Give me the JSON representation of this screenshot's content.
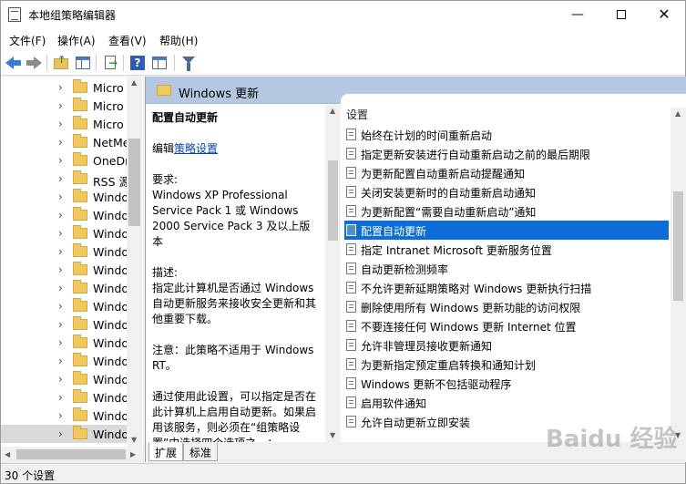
{
  "window": {
    "title": "本地组策略编辑器",
    "minimize_glyph": "—",
    "close_glyph": "✕"
  },
  "menu": [
    "文件(F)",
    "操作(A)",
    "查看(V)",
    "帮助(H)"
  ],
  "tree": {
    "items": [
      "Micro",
      "Micro",
      "Micro",
      "NetMe",
      "OneDr",
      "RSS 源",
      "Windo",
      "Windo",
      "Windo",
      "Windo",
      "Windo",
      "Windo",
      "Windo",
      "Windo",
      "Windo",
      "Windo",
      "Windo",
      "Windo",
      "Windo",
      "Windo"
    ],
    "selected_index": 19,
    "chevron": "›"
  },
  "panel": {
    "header": "Windows 更新",
    "description": {
      "title": "配置自动更新",
      "edit_prefix": "编辑",
      "edit_link": "策略设置",
      "requirements_label": "要求:",
      "requirements_text": "Windows XP Professional Service Pack 1 或 Windows 2000 Service Pack 3 及以上版本",
      "desc_label": "描述:",
      "desc_text": "指定此计算机是否通过 Windows 自动更新服务来接收安全更新和其他重要下载。",
      "note_text": "注意：此策略不适用于 Windows RT。",
      "usage_text": "通过使用此设置，可以指定是否在此计算机上启用自动更新。如果启用该服务，则必须在“组策略设置”中选择四个选项之一："
    },
    "list_header": "设置",
    "settings": [
      "始终在计划的时间重新启动",
      "指定更新安装进行自动重新启动之前的最后期限",
      "为更新配置自动重新启动提醒通知",
      "关闭安装更新时的自动重新启动通知",
      "为更新配置“需要自动重新启动”通知",
      "配置自动更新",
      "指定 Intranet Microsoft 更新服务位置",
      "自动更新检测频率",
      "不允许更新延期策略对 Windows 更新执行扫描",
      "删除使用所有 Windows 更新功能的访问权限",
      "不要连接任何 Windows 更新 Internet 位置",
      "允许非管理员接收更新通知",
      "为更新指定预定重启转换和通知计划",
      "Windows 更新不包括驱动程序",
      "启用软件通知",
      "允许自动更新立即安装"
    ],
    "selected_setting_index": 5,
    "tabs": [
      "扩展",
      "标准"
    ],
    "active_tab": 0
  },
  "status": "30 个设置",
  "watermark": "Baidu 经验",
  "colors": {
    "selection": "#0b6dd5",
    "header_band": "#b4c8e1",
    "link": "#0645ad",
    "folder": "#f0c860"
  }
}
